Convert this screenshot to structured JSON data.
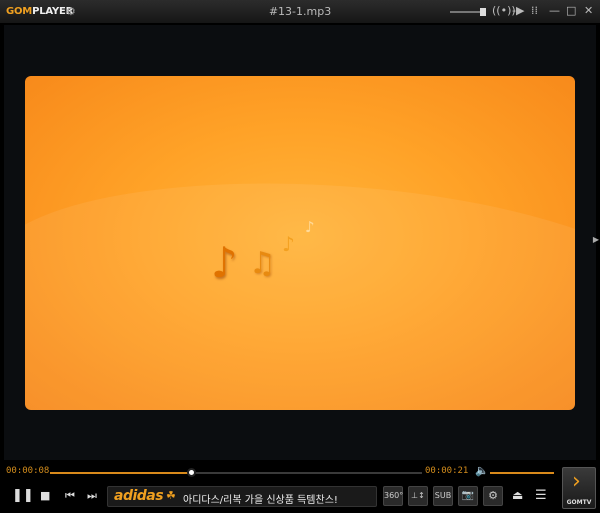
{
  "app": {
    "logo_brand": "GOM",
    "logo_suffix": "PLAYER",
    "window_title": "#13-1.mp3"
  },
  "titlebar_icons": {
    "settings": "⚙",
    "broadcast": "((•))",
    "pin": "-▶",
    "bars": "⁞⁞",
    "minimize": "—",
    "maximize": "□",
    "close": "✕"
  },
  "video": {
    "notes": [
      "♪",
      "♫",
      "♪",
      "♪"
    ]
  },
  "playback": {
    "current_time": "00:00:08",
    "total_time": "00:00:21",
    "progress": 0.38,
    "volume": 1.0
  },
  "ad": {
    "brand": "adidas",
    "text": "아디다스/리복 가을 신상품 득템찬스!"
  },
  "buttons": {
    "pause": "❚❚",
    "stop": "■",
    "prev": "⏮",
    "next": "⏭",
    "view_360": "360°",
    "equalizer": "⊥↕",
    "subtitle": "SUB",
    "capture": "📷",
    "effects": "⚙",
    "eject": "⏏",
    "menu": "☰",
    "gomtv_arrow": "›",
    "gomtv_label": "GOMTV"
  },
  "colors": {
    "accent": "#d98a1b",
    "screen": "#ffa227"
  }
}
